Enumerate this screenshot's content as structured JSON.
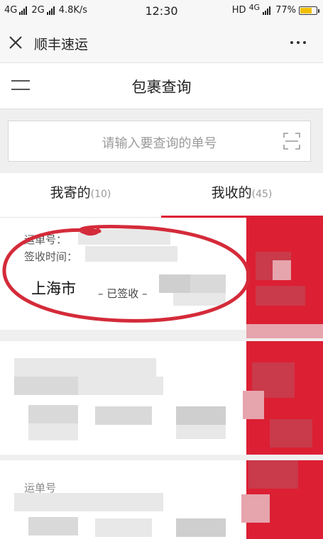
{
  "status_bar": {
    "net1": "4G",
    "net2": "2G",
    "speed": "4.8K/s",
    "time": "12:30",
    "hd": "HD",
    "net3": "4G",
    "battery": "77%",
    "battery_level": 0.77
  },
  "titlebar": {
    "title": "顺丰速运"
  },
  "header": {
    "title": "包裹查询"
  },
  "search": {
    "placeholder": "请输入要查询的单号"
  },
  "tabs": [
    {
      "label": "我寄的",
      "count": "(10)"
    },
    {
      "label": "我收的",
      "count": "(45)"
    }
  ],
  "cards": [
    {
      "waybill_label": "运单号：",
      "sign_time_label": "签收时间：",
      "city": "上海市",
      "status": "– 已签收 –"
    },
    {
      "waybill_label": "运单号"
    }
  ],
  "colors": {
    "accent": "#dc1f33",
    "annotation": "#d42b3a"
  }
}
